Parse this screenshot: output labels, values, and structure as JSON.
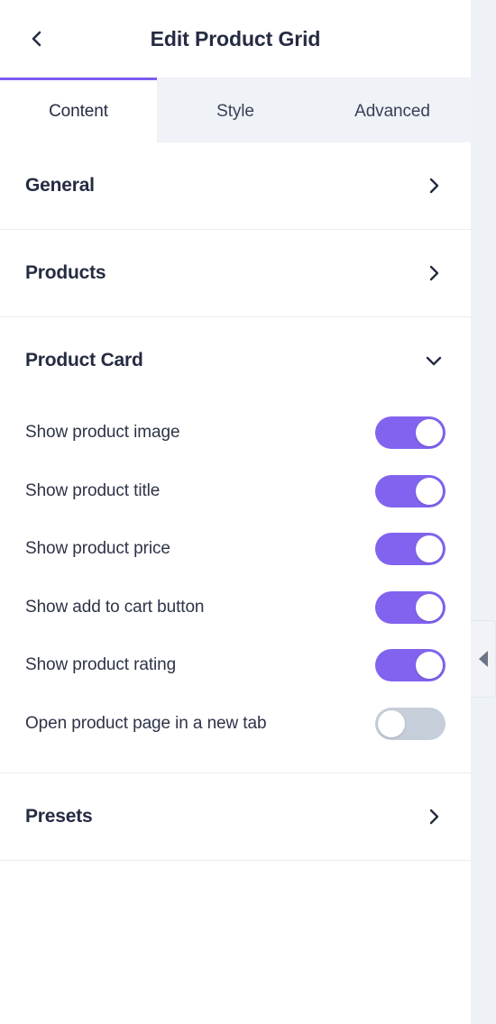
{
  "header": {
    "title": "Edit Product Grid",
    "back_icon": "chevron-left-icon"
  },
  "tabs": [
    {
      "id": "content",
      "label": "Content",
      "active": true
    },
    {
      "id": "style",
      "label": "Style",
      "active": false
    },
    {
      "id": "advanced",
      "label": "Advanced",
      "active": false
    }
  ],
  "sections": [
    {
      "id": "general",
      "title": "General",
      "expanded": false,
      "chevron": "chevron-right-icon"
    },
    {
      "id": "products",
      "title": "Products",
      "expanded": false,
      "chevron": "chevron-right-icon"
    },
    {
      "id": "product-card",
      "title": "Product Card",
      "expanded": true,
      "chevron": "chevron-down-icon"
    },
    {
      "id": "presets",
      "title": "Presets",
      "expanded": false,
      "chevron": "chevron-right-icon"
    }
  ],
  "product_card_settings": [
    {
      "id": "show-product-image",
      "label": "Show product image",
      "enabled": true
    },
    {
      "id": "show-product-title",
      "label": "Show product title",
      "enabled": true
    },
    {
      "id": "show-product-price",
      "label": "Show product price",
      "enabled": true
    },
    {
      "id": "show-add-to-cart",
      "label": "Show add to cart button",
      "enabled": true
    },
    {
      "id": "show-product-rating",
      "label": "Show product rating",
      "enabled": true
    },
    {
      "id": "open-in-new-tab",
      "label": "Open product page in a new tab",
      "enabled": false
    }
  ],
  "collapse_handle": {
    "icon": "triangle-left-icon",
    "label": "Collapse panel"
  },
  "colors": {
    "accent": "#7d5cf0",
    "toggle_on": "#8263ef",
    "toggle_off": "#c6ceda",
    "text_primary": "#252b42",
    "text_secondary": "#394159",
    "panel_bg": "#ffffff",
    "tab_inactive_bg": "#eff2f7",
    "canvas_bg": "#eef1f6",
    "divider": "#e9ecf1"
  }
}
